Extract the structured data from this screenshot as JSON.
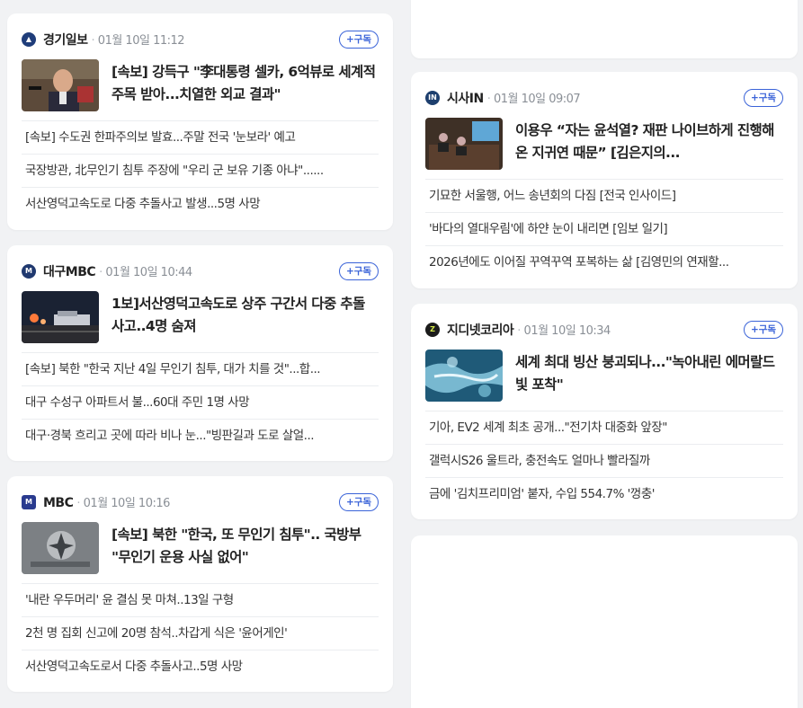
{
  "subscribe_label": "+구독",
  "cards": [
    {
      "press": "경기일보",
      "datetime": "01월 10일 11:12",
      "logo_color": "#1f3d7a",
      "headline": "[속보] 강득구 \"李대통령 셀카, 6억뷰로 세계적 주목 받아...치열한 외교 결과\"",
      "items": [
        "[속보] 수도권 한파주의보 발효...주말 전국 '눈보라' 예고",
        "국장방관, 北무인기 침투 주장에 \"우리 군 보유 기종 아냐\"......",
        "서산영덕고속도로 다중 추돌사고 발생...5명 사망"
      ]
    },
    {
      "press": "대구MBC",
      "datetime": "01월 10일 10:44",
      "logo_color": "#20396f",
      "headline": "1보]서산영덕고속도로 상주 구간서 다중 추돌 사고..4명 숨져",
      "items": [
        "[속보] 북한 \"한국 지난 4일 무인기 침투, 대가 치를 것\"...합...",
        "대구 수성구 아파트서 불...60대 주민 1명 사망",
        "대구·경북 흐리고 곳에 따라 비나 눈...\"빙판길과 도로 살얼..."
      ]
    },
    {
      "press": "MBC",
      "datetime": "01월 10일 10:16",
      "logo_color": "#2a3b8f",
      "headline": "[속보] 북한 \"한국, 또 무인기 침투\".. 국방부 \"무인기 운용 사실 없어\"",
      "items": [
        "'내란 우두머리' 윤 결심 못 마쳐..13일 구형",
        "2천 명 집회 신고에 20명 참석..차갑게 식은 '윤어게인'",
        "서산영덕고속도로서 다중 추돌사고..5명 사망"
      ]
    },
    {
      "press": "시사IN",
      "datetime": "01월 10일 09:07",
      "logo_color": "#1d3f6e",
      "headline": "이용우 “자는 윤석열? 재판 나이브하게 진행해온 지귀연 때문” [김은지의...",
      "items": [
        "기묘한 서울행, 어느 송년회의 다짐 [전국 인사이드]",
        "'바다의 열대우림'에 하얀 눈이 내리면 [임보 일기]",
        "2026년에도 이어질 꾸역꾸역 포복하는 삶 [김영민의 연재할..."
      ]
    },
    {
      "press": "지디넷코리아",
      "datetime": "01월 10일 10:34",
      "logo_color": "#1b1b1b",
      "headline": "세계 최대 빙산 붕괴되나...\"녹아내린 에머랄드 빛 포착\"",
      "items": [
        "기아, EV2 세계 최초 공개...\"전기차 대중화 앞장\"",
        "갤럭시S26 울트라, 충전속도 얼마나 빨라질까",
        "금에 '김치프리미엄' 붙자, 수입 554.7% '껑충'"
      ]
    }
  ]
}
